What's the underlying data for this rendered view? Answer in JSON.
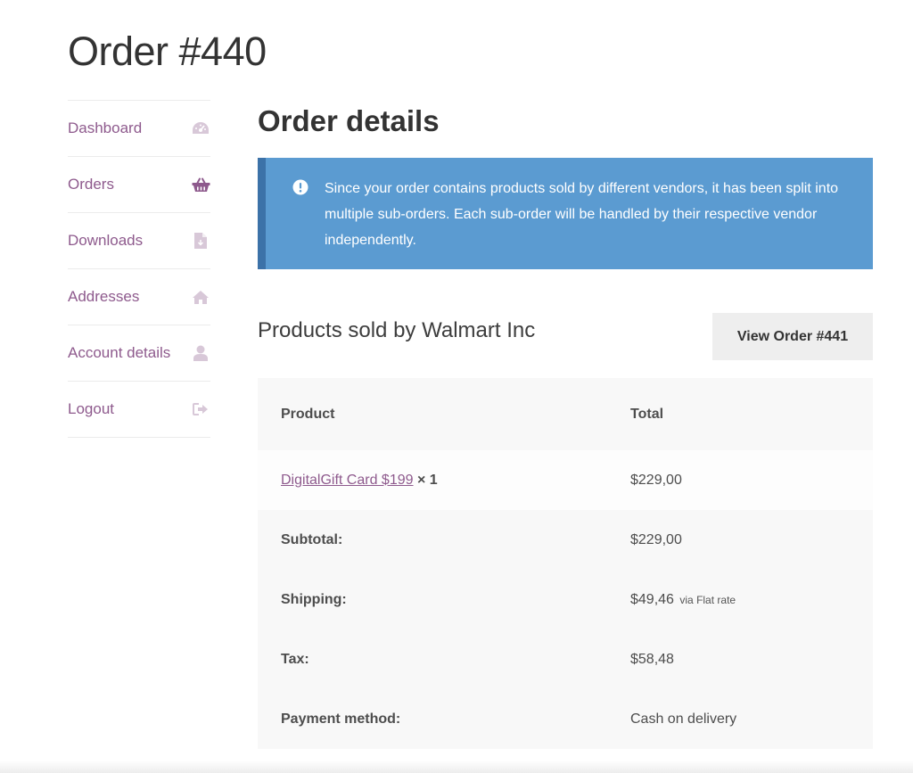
{
  "page": {
    "title": "Order #440"
  },
  "sidebar": {
    "items": [
      {
        "label": "Dashboard",
        "icon": "dashboard-gauge-icon"
      },
      {
        "label": "Orders",
        "icon": "shopping-basket-icon"
      },
      {
        "label": "Downloads",
        "icon": "file-download-icon"
      },
      {
        "label": "Addresses",
        "icon": "home-icon"
      },
      {
        "label": "Account details",
        "icon": "user-icon"
      },
      {
        "label": "Logout",
        "icon": "sign-out-icon"
      }
    ]
  },
  "main": {
    "section_title": "Order details",
    "notice": {
      "icon": "exclamation-circle-icon",
      "text": "Since your order contains products sold by different vendors, it has been split into multiple sub-orders. Each sub-order will be handled by their respective vendor independently."
    },
    "vendor": {
      "title": "Products sold by Walmart Inc",
      "view_order_label": "View Order #441"
    },
    "table": {
      "headers": {
        "product": "Product",
        "total": "Total"
      },
      "item": {
        "name": "DigitalGift Card $199",
        "qty": "× 1",
        "total": "$229,00"
      },
      "totals": [
        {
          "label": "Subtotal:",
          "value": "$229,00",
          "note": ""
        },
        {
          "label": "Shipping:",
          "value": "$49,46",
          "note": "via Flat rate"
        },
        {
          "label": "Tax:",
          "value": "$58,48",
          "note": ""
        },
        {
          "label": "Payment method:",
          "value": "Cash on delivery",
          "note": ""
        }
      ]
    }
  },
  "colors": {
    "link": "#8e5a8d",
    "notice_bg": "#5b9bd1",
    "notice_border": "#3c72a8",
    "row_bg": "#f8f8f8",
    "icon_light": "#d8c8d8",
    "icon_active": "#8e5a8d"
  }
}
